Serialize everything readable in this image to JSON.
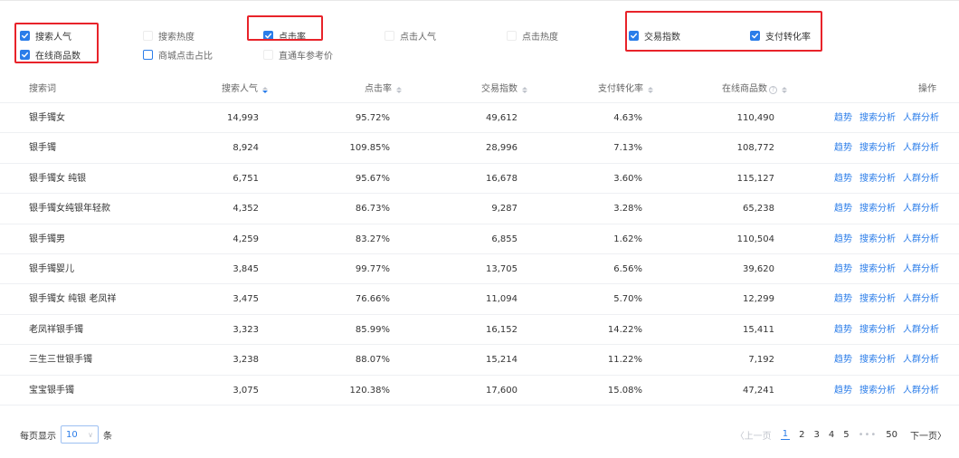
{
  "filters": [
    {
      "label": "搜索人气",
      "checked": true
    },
    {
      "label": "搜索热度",
      "checked": false
    },
    {
      "label": "点击率",
      "checked": true
    },
    {
      "label": "点击人气",
      "checked": false
    },
    {
      "label": "点击热度",
      "checked": false
    },
    {
      "label": "交易指数",
      "checked": true
    },
    {
      "label": "支付转化率",
      "checked": true
    },
    {
      "label": "在线商品数",
      "checked": true
    },
    {
      "label": "商城点击占比",
      "checked": false
    },
    {
      "label": "直通车参考价",
      "checked": false
    }
  ],
  "table": {
    "headers": {
      "keyword": "搜索词",
      "search_popularity": "搜索人气",
      "ctr": "点击率",
      "trade_index": "交易指数",
      "pay_conversion": "支付转化率",
      "online_items": "在线商品数",
      "actions": "操作"
    },
    "rows": [
      {
        "keyword": "银手镯女",
        "search_popularity": "14,993",
        "ctr": "95.72%",
        "trade_index": "49,612",
        "pay_conversion": "4.63%",
        "online_items": "110,490"
      },
      {
        "keyword": "银手镯",
        "search_popularity": "8,924",
        "ctr": "109.85%",
        "trade_index": "28,996",
        "pay_conversion": "7.13%",
        "online_items": "108,772"
      },
      {
        "keyword": "银手镯女 纯银",
        "search_popularity": "6,751",
        "ctr": "95.67%",
        "trade_index": "16,678",
        "pay_conversion": "3.60%",
        "online_items": "115,127"
      },
      {
        "keyword": "银手镯女纯银年轻款",
        "search_popularity": "4,352",
        "ctr": "86.73%",
        "trade_index": "9,287",
        "pay_conversion": "3.28%",
        "online_items": "65,238"
      },
      {
        "keyword": "银手镯男",
        "search_popularity": "4,259",
        "ctr": "83.27%",
        "trade_index": "6,855",
        "pay_conversion": "1.62%",
        "online_items": "110,504"
      },
      {
        "keyword": "银手镯婴儿",
        "search_popularity": "3,845",
        "ctr": "99.77%",
        "trade_index": "13,705",
        "pay_conversion": "6.56%",
        "online_items": "39,620"
      },
      {
        "keyword": "银手镯女 纯银 老凤祥",
        "search_popularity": "3,475",
        "ctr": "76.66%",
        "trade_index": "11,094",
        "pay_conversion": "5.70%",
        "online_items": "12,299"
      },
      {
        "keyword": "老凤祥银手镯",
        "search_popularity": "3,323",
        "ctr": "85.99%",
        "trade_index": "16,152",
        "pay_conversion": "14.22%",
        "online_items": "15,411"
      },
      {
        "keyword": "三生三世银手镯",
        "search_popularity": "3,238",
        "ctr": "88.07%",
        "trade_index": "15,214",
        "pay_conversion": "11.22%",
        "online_items": "7,192"
      },
      {
        "keyword": "宝宝银手镯",
        "search_popularity": "3,075",
        "ctr": "120.38%",
        "trade_index": "17,600",
        "pay_conversion": "15.08%",
        "online_items": "47,241"
      }
    ],
    "row_actions": [
      "趋势",
      "搜索分析",
      "人群分析"
    ]
  },
  "footer": {
    "per_page_prefix": "每页显示",
    "per_page_value": "10",
    "per_page_suffix": "条",
    "prev_label": "〈上一页",
    "pages": [
      "1",
      "2",
      "3",
      "4",
      "5"
    ],
    "ellipsis": "•••",
    "last_page": "50",
    "next_label": "下一页〉",
    "current_page": "1"
  },
  "colors": {
    "accent": "#2b7de9",
    "highlight_box": "#e8232a"
  }
}
